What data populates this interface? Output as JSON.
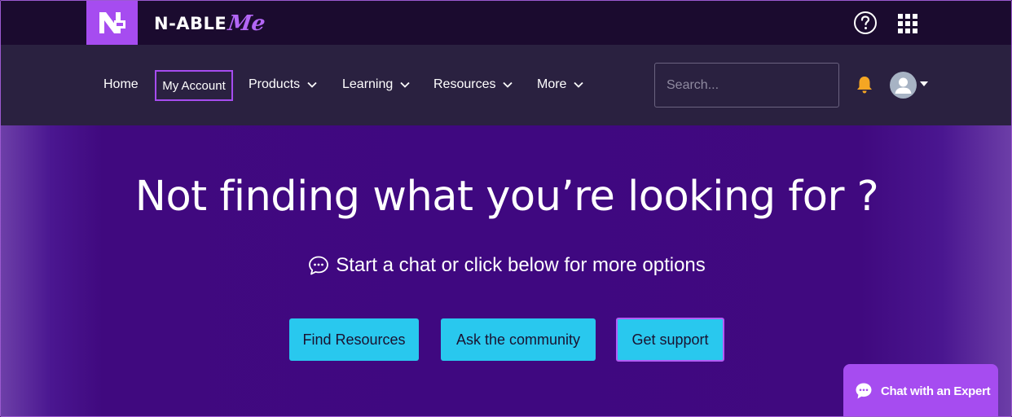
{
  "brand": {
    "name": "N-ABLE",
    "suffix": "Me"
  },
  "topbar": {
    "help_icon": "question-circle-icon",
    "apps_icon": "grid-apps-icon"
  },
  "nav": {
    "items": [
      {
        "label": "Home"
      },
      {
        "label": "My Account"
      },
      {
        "label": "Products"
      },
      {
        "label": "Learning"
      },
      {
        "label": "Resources"
      },
      {
        "label": "More"
      }
    ],
    "search": {
      "placeholder": "Search...",
      "value": ""
    },
    "bell_icon": "bell-icon",
    "avatar_icon": "user-avatar-icon"
  },
  "hero": {
    "title": "Not finding what you’re looking for ?",
    "subtitle": "Start a chat or click below for more options",
    "buttons": [
      {
        "label": "Find Resources"
      },
      {
        "label": "Ask the community"
      },
      {
        "label": "Get support"
      }
    ]
  },
  "chat_widget": {
    "label": "Chat with an Expert"
  },
  "colors": {
    "accent_purple": "#a64cf0",
    "cta_cyan": "#29c8ee",
    "nav_bg": "#2a2140",
    "hero_bg": "#3f0880",
    "bell_yellow": "#f5a623"
  }
}
